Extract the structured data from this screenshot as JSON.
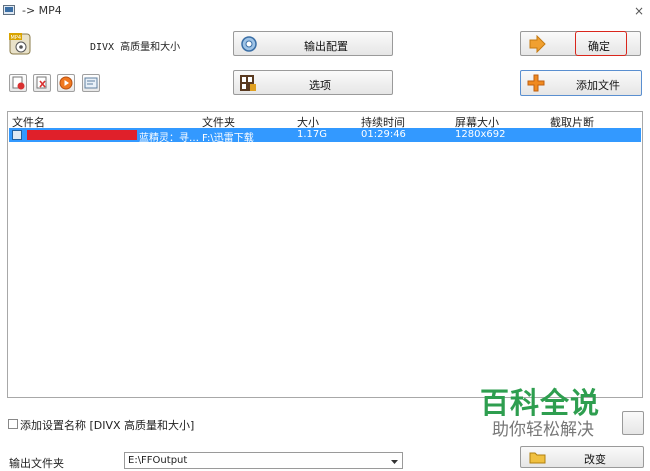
{
  "window": {
    "title": "-> MP4",
    "close": "×"
  },
  "preset": {
    "name": "DIVX 高质量和大小"
  },
  "buttons": {
    "output_config": "输出配置",
    "options": "选项",
    "ok": "确定",
    "add_file": "添加文件",
    "change": "改变"
  },
  "list": {
    "headers": [
      "文件名",
      "文件夹",
      "大小",
      "持续时间",
      "屏幕大小",
      "截取片断"
    ],
    "rows": [
      {
        "name_suffix": "蓝精灵：寻…",
        "folder": "F:\\迅雷下载",
        "size": "1.17G",
        "duration": "01:29:46",
        "screen": "1280x692",
        "clip": ""
      }
    ]
  },
  "footer": {
    "add_setting_label": "添加设置名称 [DIVX 高质量和大小]",
    "output_folder_label": "输出文件夹",
    "output_folder_value": "E:\\FFOutput"
  },
  "watermark": {
    "line1": "百科全说",
    "line2": "助你轻松解决"
  },
  "colors": {
    "selection": "#3399ff",
    "highlight_border": "#d9261c",
    "watermark_green": "#2e9e4f"
  },
  "icons": [
    "app-icon",
    "preset-icon",
    "gear-icon",
    "film-icon",
    "arrow-right-icon",
    "plus-icon",
    "folder-icon"
  ]
}
